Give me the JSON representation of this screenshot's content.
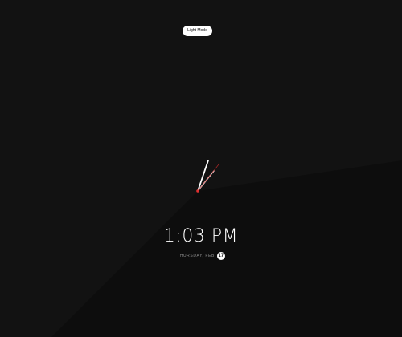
{
  "theme_toggle": {
    "label": "Light Mode"
  },
  "clock": {
    "time": "1:03 PM",
    "weekday_month": "THURSDAY, FEB",
    "day": "17",
    "accent_color": "#e03030"
  }
}
